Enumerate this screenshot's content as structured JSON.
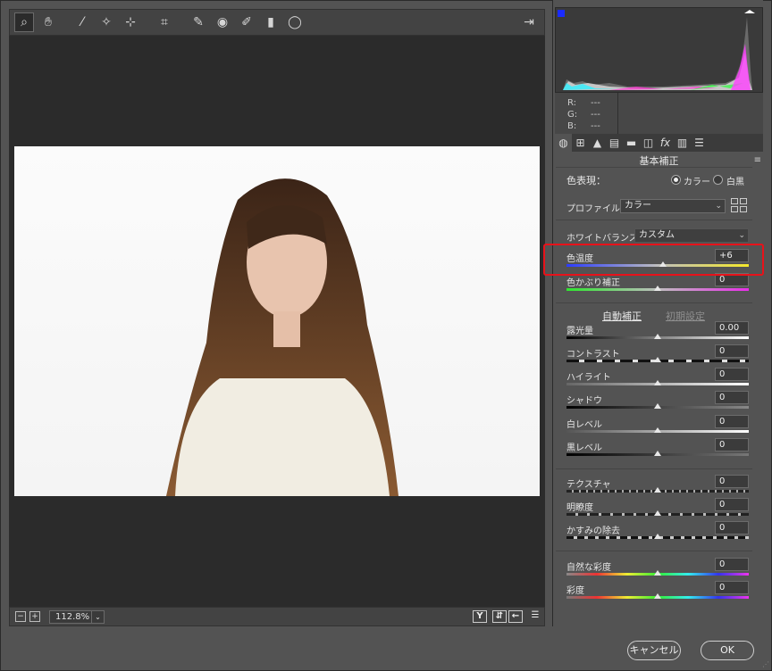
{
  "toolbar": {
    "tools": [
      {
        "icon": "zoom-icon",
        "glyph": "🔍︎"
      },
      {
        "icon": "hand-icon",
        "glyph": "✋︎"
      },
      {
        "icon": "white-balance-eyedropper-icon",
        "glyph": "⁄"
      },
      {
        "icon": "color-sampler-icon",
        "glyph": "✧"
      },
      {
        "icon": "target-adjust-icon",
        "glyph": "⊹"
      },
      {
        "icon": "crop-icon",
        "glyph": "⌗"
      },
      {
        "icon": "spot-removal-icon",
        "glyph": "✎"
      },
      {
        "icon": "red-eye-icon",
        "glyph": "◉"
      },
      {
        "icon": "adjustment-brush-icon",
        "glyph": "✐"
      },
      {
        "icon": "graduated-filter-icon",
        "glyph": "▮"
      },
      {
        "icon": "radial-filter-icon",
        "glyph": "◯"
      }
    ],
    "export_icon": "export-icon"
  },
  "status": {
    "zoom": "112.8%"
  },
  "rgb": {
    "r_label": "R:",
    "g_label": "G:",
    "b_label": "B:",
    "r": "---",
    "g": "---",
    "b": "---"
  },
  "panel": {
    "title": "基本補正",
    "treatment_label": "色表現：",
    "color_option": "カラー",
    "bw_option": "白黒",
    "treatment_selected": "color",
    "profile_label": "プロファイル：",
    "profile_value": "カラー",
    "wb_label": "ホワイトバランス：",
    "wb_value": "カスタム",
    "auto_label": "自動補正",
    "default_label": "初期設定"
  },
  "sliders": [
    {
      "key": "temp",
      "label": "色温度",
      "value": "+6",
      "pos": 0.53
    },
    {
      "key": "tint",
      "label": "色かぶり補正",
      "value": "0",
      "pos": 0.5
    },
    {
      "key": "exposure",
      "label": "露光量",
      "value": "0.00",
      "pos": 0.5
    },
    {
      "key": "contrast",
      "label": "コントラスト",
      "value": "0",
      "pos": 0.5
    },
    {
      "key": "highlights",
      "label": "ハイライト",
      "value": "0",
      "pos": 0.5
    },
    {
      "key": "shadows",
      "label": "シャドウ",
      "value": "0",
      "pos": 0.5
    },
    {
      "key": "whites",
      "label": "白レベル",
      "value": "0",
      "pos": 0.5
    },
    {
      "key": "blacks",
      "label": "黒レベル",
      "value": "0",
      "pos": 0.5
    },
    {
      "key": "texture",
      "label": "テクスチャ",
      "value": "0",
      "pos": 0.5
    },
    {
      "key": "clarity",
      "label": "明瞭度",
      "value": "0",
      "pos": 0.5
    },
    {
      "key": "dehaze",
      "label": "かすみの除去",
      "value": "0",
      "pos": 0.5
    },
    {
      "key": "vibrance",
      "label": "自然な彩度",
      "value": "0",
      "pos": 0.5
    },
    {
      "key": "saturation",
      "label": "彩度",
      "value": "0",
      "pos": 0.5
    }
  ],
  "buttons": {
    "cancel": "キャンセル",
    "ok": "OK"
  },
  "colors": {
    "highlight": "#e8121a",
    "panel_bg": "#535353",
    "preview_bg": "#2b2b2b"
  }
}
